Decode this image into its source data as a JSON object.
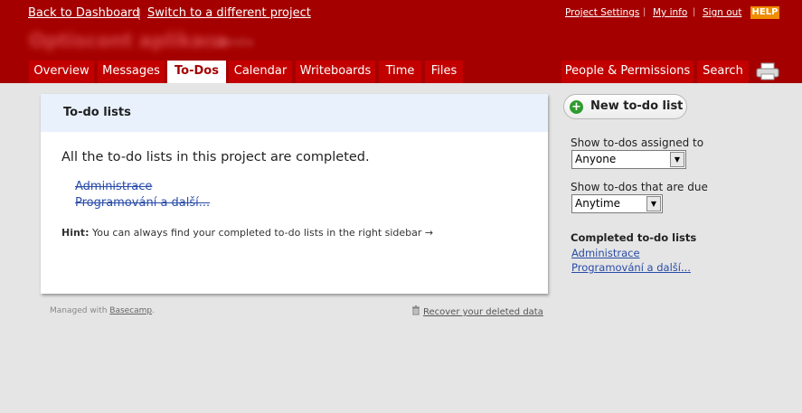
{
  "header": {
    "back_to_dashboard": "Back to Dashboard",
    "separator": "|",
    "switch_project": "Switch to a different project",
    "project_settings": "Project Settings",
    "my_info": "My info",
    "sign_out": "Sign out",
    "help": "HELP",
    "project_name": "Optiscont aplikace",
    "company_name": "Lasisto"
  },
  "tabs": {
    "overview": "Overview",
    "messages": "Messages",
    "todos": "To-Dos",
    "calendar": "Calendar",
    "writeboards": "Writeboards",
    "time": "Time",
    "files": "Files",
    "people": "People & Permissions",
    "search": "Search"
  },
  "panel": {
    "title": "To-do lists",
    "message": "All the to-do lists in this project are completed.",
    "completed_lists": [
      "Administrace",
      "Programování a další..."
    ],
    "hint_label": "Hint:",
    "hint_text": " You can always find your completed to-do lists in the right sidebar →"
  },
  "footer": {
    "managed_with": "Managed with ",
    "basecamp": "Basecamp",
    "period": ".",
    "recover": "Recover your deleted data"
  },
  "sidebar": {
    "new_list_button": "New to-do list",
    "assigned_label": "Show to-dos assigned to",
    "assigned_value": "Anyone",
    "due_label": "Show to-dos that are due",
    "due_value": "Anytime",
    "completed_heading": "Completed to-do lists",
    "completed_links": [
      "Administrace",
      "Programování a další..."
    ]
  },
  "colors": {
    "header_red": "#a50000",
    "tab_red": "#c20000",
    "help_orange": "#f08d00",
    "link_blue": "#2a4ca8"
  }
}
